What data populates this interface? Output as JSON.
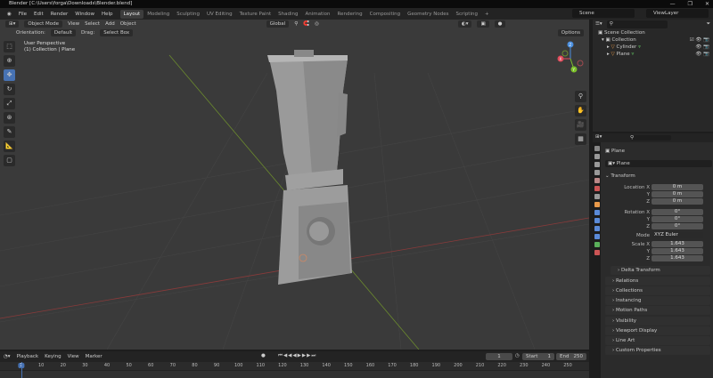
{
  "title": "Blender [C:\\Users\\forga\\Downloads\\Blender.blend]",
  "window_controls": [
    "—",
    "❐",
    "✕"
  ],
  "menu": [
    "File",
    "Edit",
    "Render",
    "Window",
    "Help"
  ],
  "workspaces": [
    "Layout",
    "Modeling",
    "Sculpting",
    "UV Editing",
    "Texture Paint",
    "Shading",
    "Animation",
    "Rendering",
    "Compositing",
    "Geometry Nodes",
    "Scripting",
    "+"
  ],
  "scene": "Scene",
  "view_layer": "ViewLayer",
  "viewport": {
    "mode": "Object Mode",
    "menus": [
      "View",
      "Select",
      "Add",
      "Object"
    ],
    "transform_orientation": "Global",
    "orientation_label": "Orientation:",
    "orientation_value": "Default",
    "drag_label": "Drag:",
    "drag_value": "Select Box",
    "options": "Options",
    "info_line1": "User Perspective",
    "info_line2": "(1) Collection | Plane",
    "gizmo": {
      "x": "X",
      "y": "Y",
      "z": "Z"
    }
  },
  "outliner": {
    "root": "Scene Collection",
    "collection": "Collection",
    "items": [
      "Cylinder",
      "Plane"
    ]
  },
  "properties": {
    "object_name": "Plane",
    "data_name": "Plane",
    "section": "Transform",
    "location": {
      "label": "Location X",
      "x": "0 m",
      "y": "0 m",
      "z": "0 m"
    },
    "rotation": {
      "label": "Rotation X",
      "x": "0°",
      "y": "0°",
      "z": "0°"
    },
    "mode_label": "Mode",
    "mode": "XYZ Euler",
    "scale": {
      "label": "Scale X",
      "x": "1.643",
      "y": "1.643",
      "z": "1.643"
    },
    "axis_y": "Y",
    "axis_z": "Z",
    "panels": [
      "Delta Transform",
      "Relations",
      "Collections",
      "Instancing",
      "Motion Paths",
      "Visibility",
      "Viewport Display",
      "Line Art",
      "Custom Properties"
    ]
  },
  "timeline": {
    "menus": [
      "Playback",
      "Keying",
      "View",
      "Marker"
    ],
    "current_frame": "1",
    "start_label": "Start",
    "start": "1",
    "end_label": "End",
    "end": "250",
    "ticks": [
      "1",
      "10",
      "20",
      "30",
      "40",
      "50",
      "60",
      "70",
      "80",
      "90",
      "100",
      "110",
      "120",
      "130",
      "140",
      "150",
      "160",
      "170",
      "180",
      "190",
      "200",
      "210",
      "220",
      "230",
      "240",
      "250"
    ]
  }
}
